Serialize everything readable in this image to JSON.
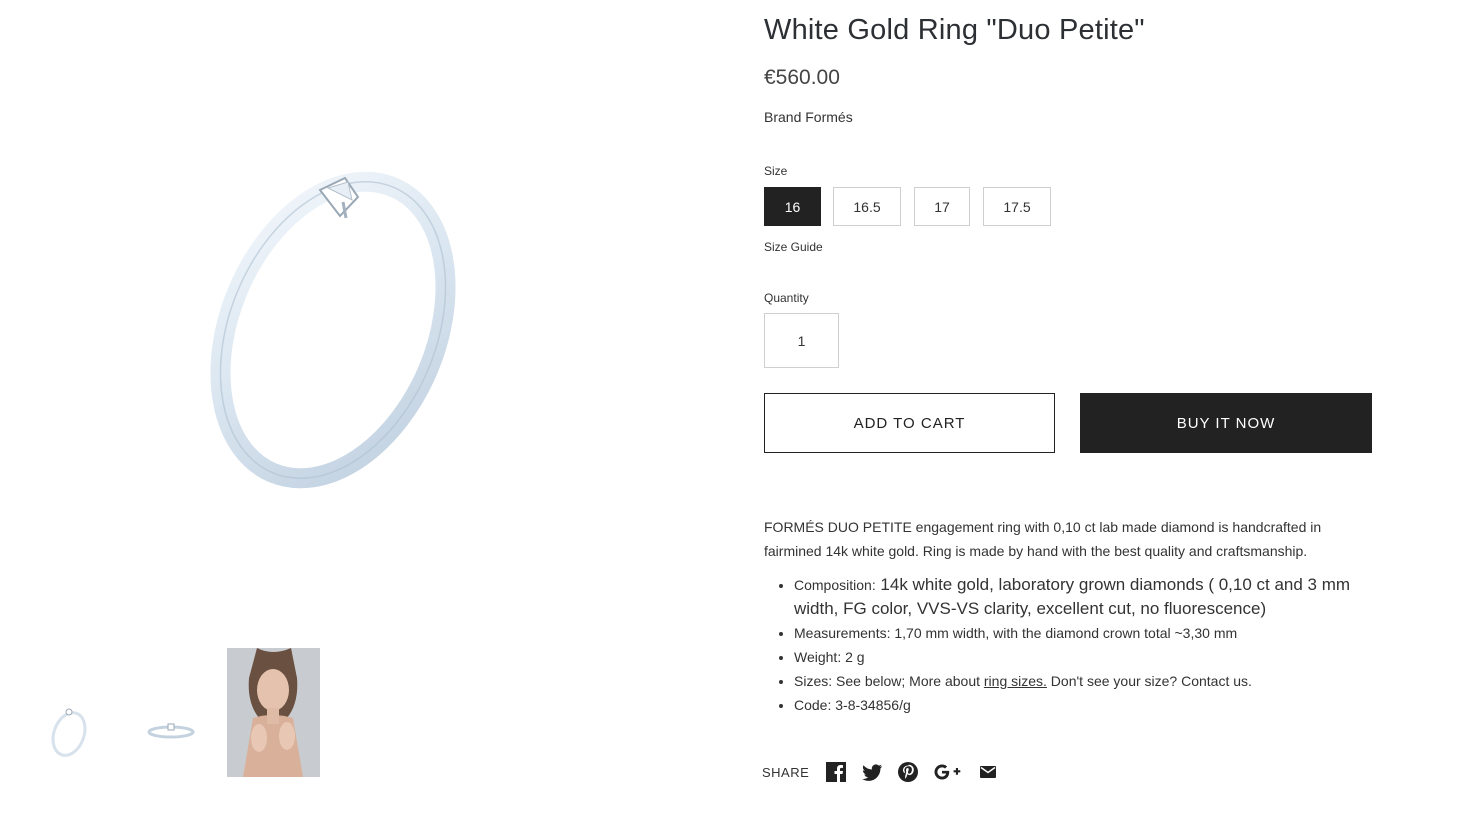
{
  "product": {
    "title": "White Gold Ring \"Duo Petite\"",
    "price": "€560.00",
    "brand": "Brand Formés"
  },
  "size": {
    "label": "Size",
    "options": [
      "16",
      "16.5",
      "17",
      "17.5"
    ],
    "selected": "16",
    "guide_label": "Size Guide"
  },
  "quantity": {
    "label": "Quantity",
    "value": "1"
  },
  "buttons": {
    "add_to_cart": "ADD TO CART",
    "buy_now": "BUY IT NOW"
  },
  "description": {
    "intro": "FORMÉS DUO PETITE engagement ring with 0,10 ct lab made diamond is handcrafted in fairmined 14k white gold. Ring is made by hand with the best quality and craftsmanship.",
    "composition_label": "Composition:",
    "composition_value": " 14k white gold, laboratory grown diamonds ( 0,10 ct and 3 mm width, FG color, VVS-VS clarity, excellent cut, no fluorescence)",
    "measurements": "Measurements: 1,70 mm width, with the diamond crown total ~3,30 mm",
    "weight": "Weight: 2 g",
    "sizes_prefix": "Sizes: See below; More about ",
    "sizes_link": "ring sizes.",
    "sizes_suffix": " Don't see your size? Contact us.",
    "code": "Code: 3-8-34856/g"
  },
  "share": {
    "label": "SHARE",
    "icons": [
      "facebook-icon",
      "twitter-icon",
      "pinterest-icon",
      "google-plus-icon",
      "email-icon"
    ]
  },
  "gallery": {
    "thumbnails": [
      "ring-side-view",
      "ring-flat-view",
      "model-photo"
    ]
  },
  "colors": {
    "dark": "#222222",
    "border": "#cfcfcf",
    "metal": "#dfe9f2"
  }
}
